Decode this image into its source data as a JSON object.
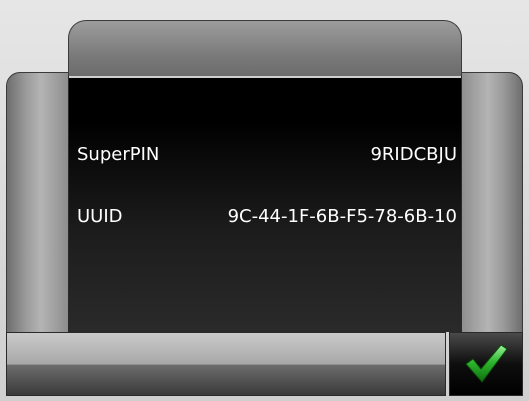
{
  "info": {
    "superpin_label": "SuperPIN",
    "superpin_value": "9RIDCBJU",
    "uuid_label": "UUID",
    "uuid_value": "9C-44-1F-6B-F5-78-6B-10"
  },
  "buttons": {
    "confirm_icon": "checkmark-icon"
  },
  "colors": {
    "panel_background": "#000000",
    "text": "#ffffff",
    "checkmark": "#2fb82f"
  }
}
